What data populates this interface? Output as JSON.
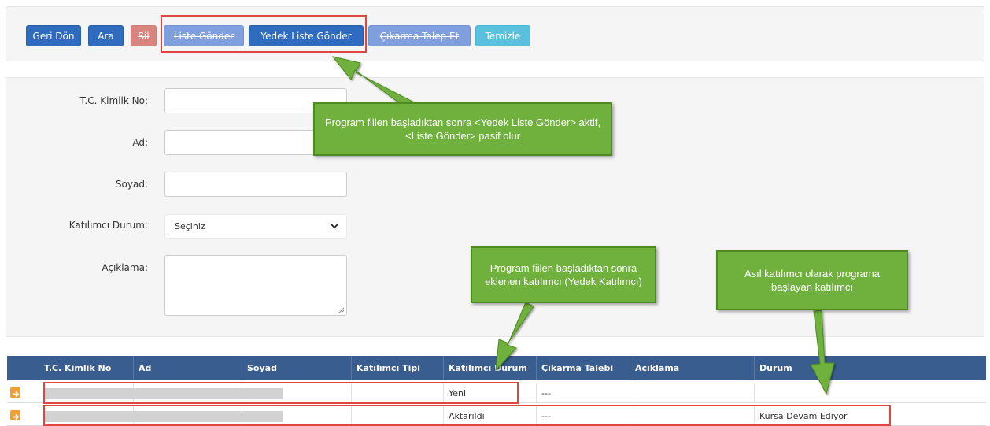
{
  "toolbar": {
    "back_label": "Geri Dön",
    "search_label": "Ara",
    "delete_label": "Sil",
    "send_list_label": "Liste Gönder",
    "send_reserve_list_label": "Yedek Liste Gönder",
    "request_removal_label": "Çıkarma Talep Et",
    "clear_label": "Temizle"
  },
  "form": {
    "tc_label": "T.C. Kimlik No:",
    "first_name_label": "Ad:",
    "last_name_label": "Soyad:",
    "status_label": "Katılımcı Durum:",
    "status_selected": "Seçiniz",
    "description_label": "Açıklama:"
  },
  "table": {
    "columns": [
      "T.C. Kimlik No",
      "Ad",
      "Soyad",
      "Katılımcı Tipi",
      "Katılımcı Durum",
      "Çıkarma Talebi",
      "Açıklama",
      "Durum"
    ],
    "rows": [
      {
        "participant_status": "Yeni",
        "removal_request": "---",
        "status": ""
      },
      {
        "participant_status": "Aktarıldı",
        "removal_request": "---",
        "status": "Kursa Devam Ediyor"
      }
    ]
  },
  "annotations": {
    "buttons_note": "Program fiilen başladıktan sonra <Yedek Liste Gönder> aktif, <Liste Gönder> pasif olur",
    "reserve_note": "Program fiilen başladıktan sonra eklenen katılımcı (Yedek Katılımcı)",
    "main_note": "Asıl katılımcı olarak programa başlayan katılımcı"
  },
  "colors": {
    "primary": "#2f6bbf",
    "header": "#3a5d8f",
    "callout": "#6fb13c",
    "highlight": "#e0453f"
  }
}
